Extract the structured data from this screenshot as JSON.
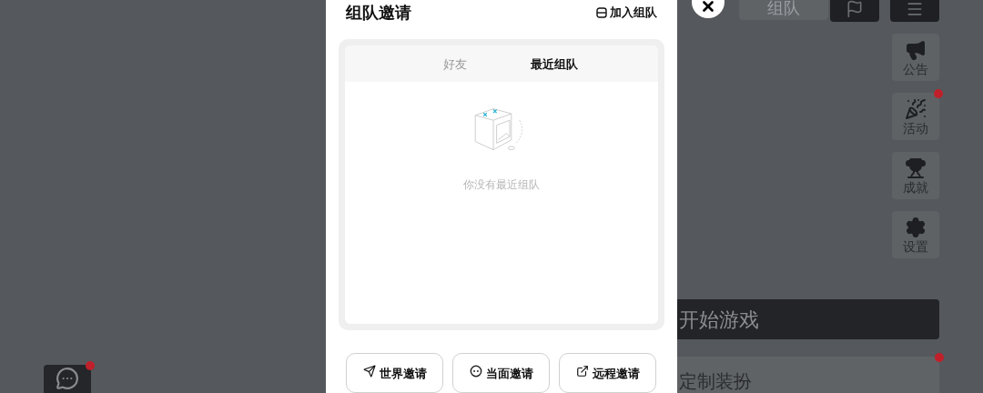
{
  "dialog": {
    "title": "组队邀请",
    "join_link": "加入组队",
    "tabs": [
      {
        "label": "好友",
        "selected": false
      },
      {
        "label": "最近组队",
        "selected": true
      }
    ],
    "empty_message": "你没有最近组队",
    "buttons": [
      {
        "kind": "world",
        "label": "世界邀请"
      },
      {
        "kind": "face",
        "label": "当面邀请"
      },
      {
        "kind": "remote",
        "label": "远程邀请"
      }
    ]
  },
  "top_bar": {
    "team_tab": "组队"
  },
  "side_menu": [
    {
      "kind": "announce",
      "label": "公告",
      "notification": false
    },
    {
      "kind": "event",
      "label": "活动",
      "notification": true
    },
    {
      "kind": "achievement",
      "label": "成就",
      "notification": false
    },
    {
      "kind": "settings",
      "label": "设置",
      "notification": false
    }
  ],
  "start_button": "开始游戏",
  "customize_button": {
    "label": "定制装扮",
    "notification": true
  },
  "chat_button": {
    "notification": true
  }
}
